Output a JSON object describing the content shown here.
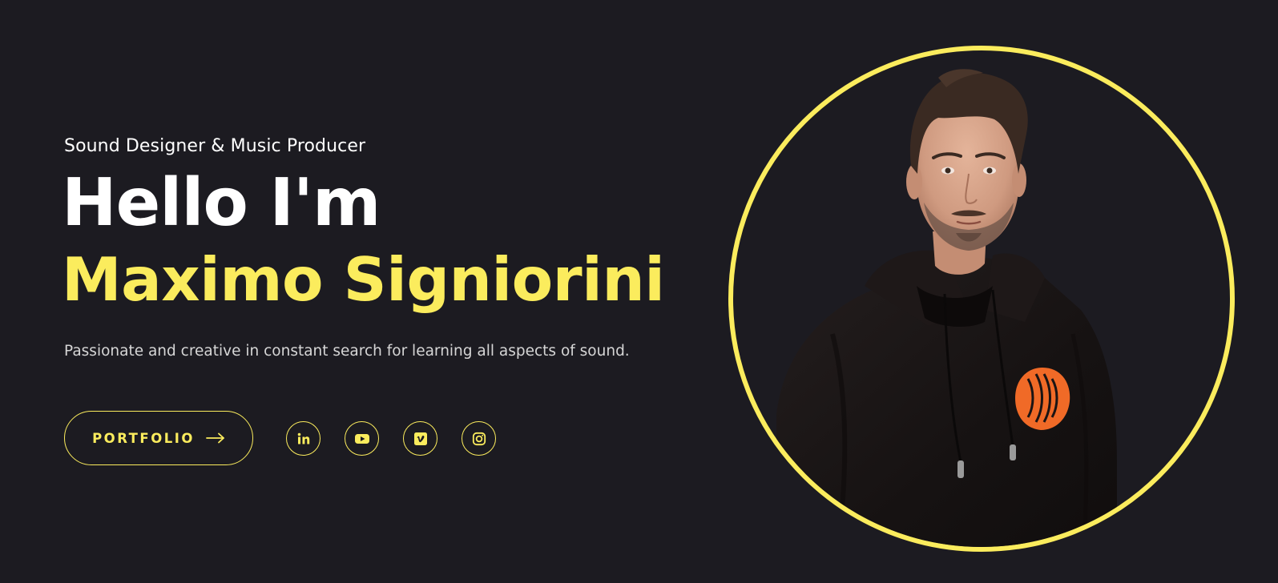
{
  "hero": {
    "subtitle": "Sound Designer & Music Producer",
    "greeting": "Hello I'm",
    "name": "Maximo Signiorini",
    "tagline": "Passionate and creative in constant search for learning all aspects of sound.",
    "portfolio_label": "PORTFOLIO"
  },
  "social_links": [
    {
      "icon": "linkedin-icon"
    },
    {
      "icon": "youtube-icon"
    },
    {
      "icon": "vimeo-icon"
    },
    {
      "icon": "instagram-icon"
    }
  ],
  "colors": {
    "background": "#1c1b21",
    "accent": "#fbec5d",
    "text": "#ffffff",
    "muted_text": "#d6d6d6",
    "hoodie": "#1a1616",
    "logo_orange": "#f06a27"
  }
}
